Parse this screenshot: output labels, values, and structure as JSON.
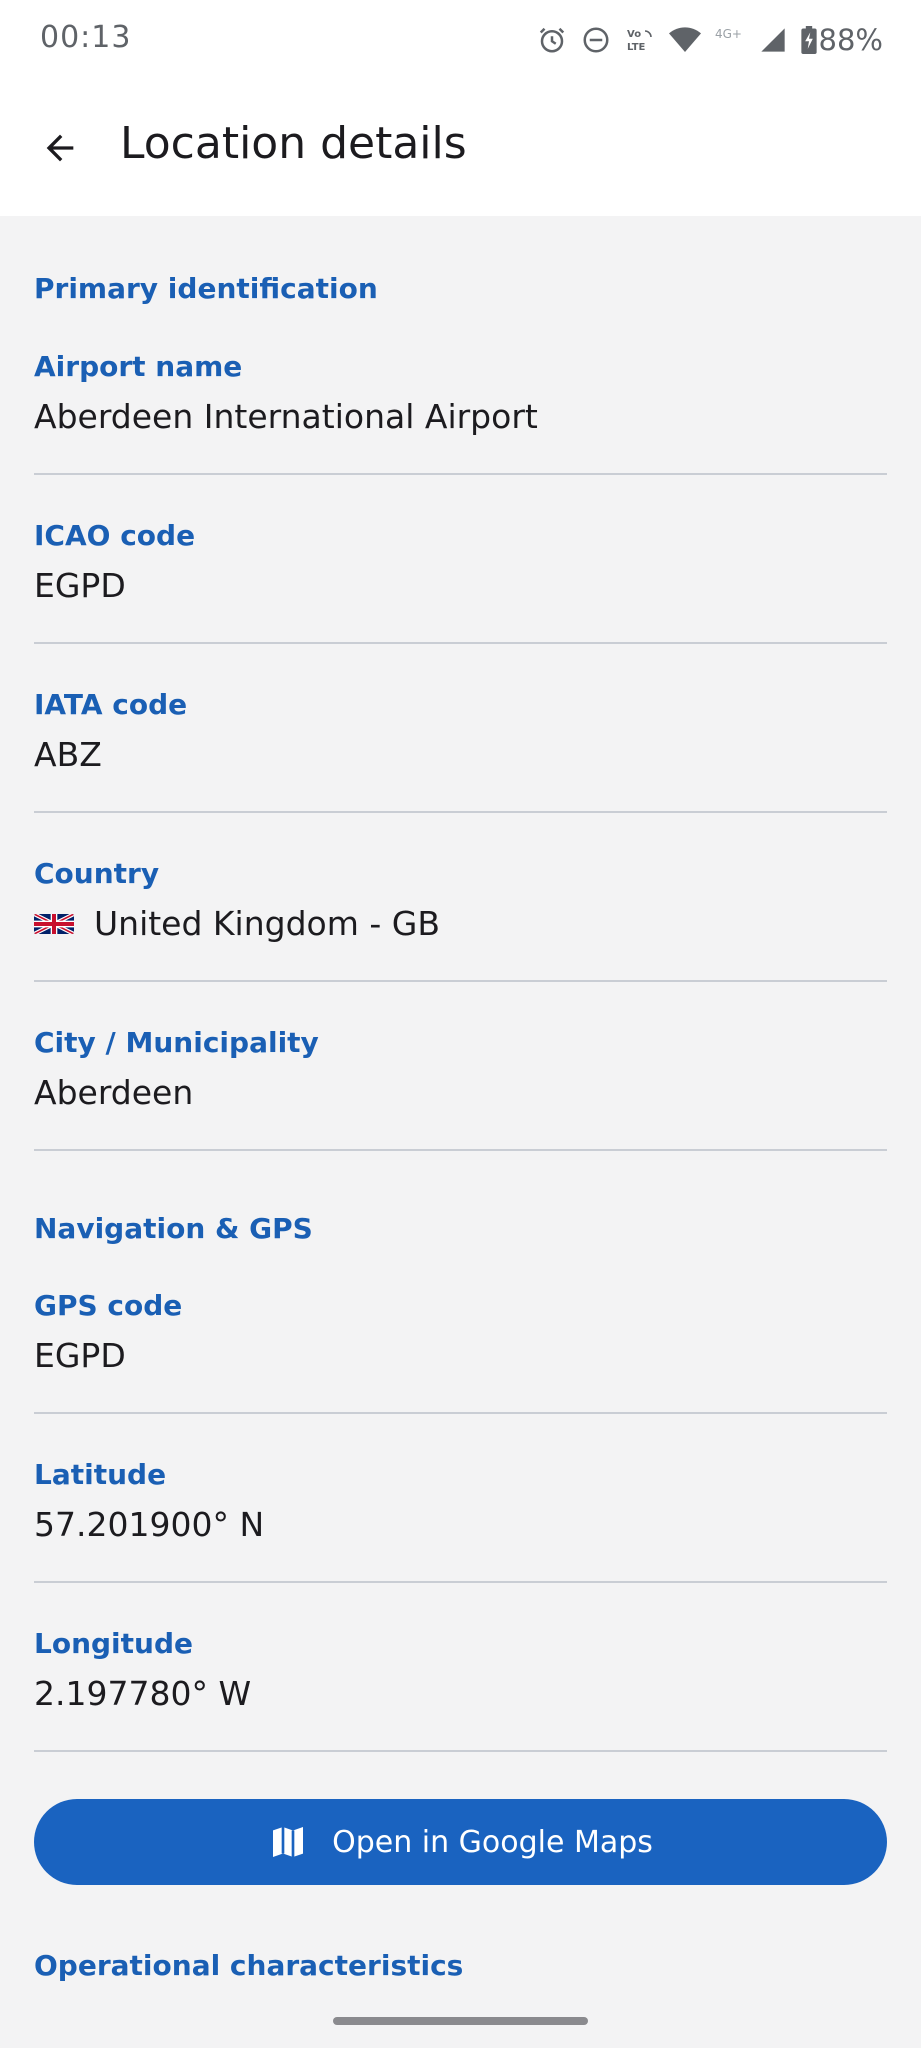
{
  "status_bar": {
    "time": "00:13",
    "icons": [
      "alarm-icon",
      "do-not-disturb-icon",
      "volte-icon",
      "wifi-icon",
      "4g-plus-icon",
      "signal-icon"
    ],
    "battery_percent": "88%"
  },
  "app_bar": {
    "title": "Location details",
    "back_icon": "arrow-back-icon"
  },
  "sections": {
    "primary": {
      "heading": "Primary identification",
      "airport_name": {
        "label": "Airport name",
        "value": "Aberdeen International Airport"
      },
      "icao": {
        "label": "ICAO code",
        "value": "EGPD"
      },
      "iata": {
        "label": "IATA code",
        "value": "ABZ"
      },
      "country": {
        "label": "Country",
        "value": "United Kingdom - GB",
        "flag_icon": "uk-flag-icon"
      },
      "city": {
        "label": "City / Municipality",
        "value": "Aberdeen"
      }
    },
    "navigation": {
      "heading": "Navigation & GPS",
      "gps": {
        "label": "GPS code",
        "value": "EGPD"
      },
      "latitude": {
        "label": "Latitude",
        "value": "57.201900° N"
      },
      "longitude": {
        "label": "Longitude",
        "value": "2.197780° W"
      }
    },
    "operational": {
      "heading": "Operational characteristics"
    }
  },
  "maps_button": {
    "label": "Open in Google Maps",
    "icon": "map-icon"
  },
  "colors": {
    "accent": "#1a5fb4",
    "button": "#1a63c0",
    "background": "#f3f3f4",
    "text": "#1c1b1f"
  }
}
